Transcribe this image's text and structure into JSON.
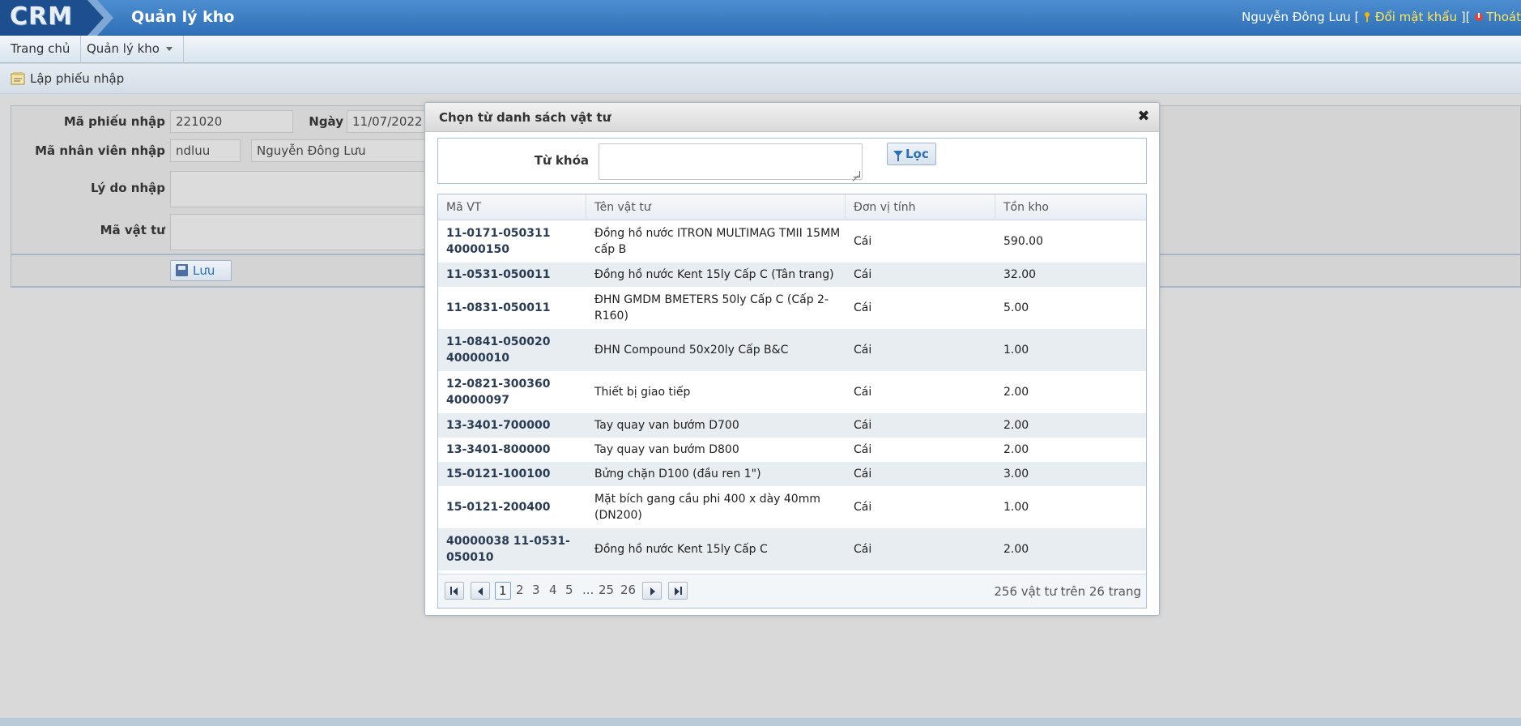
{
  "header": {
    "logo": "CRM",
    "app_title": "Quản lý kho",
    "user_name": "Nguyễn Đông Lưu [",
    "change_password": "Đổi mật khẩu",
    "separator": " ][",
    "logout": "Thoát"
  },
  "menu": {
    "items": [
      {
        "label": "Trang chủ"
      },
      {
        "label": "Quản lý kho"
      }
    ]
  },
  "page": {
    "title": "Lập phiếu nhập"
  },
  "form": {
    "receipt_code_label": "Mã phiếu nhập",
    "receipt_code_value": "221020",
    "date_label": "Ngày",
    "date_value": "11/07/2022",
    "employee_label": "Mã nhân viên nhập",
    "employee_code": "ndluu",
    "employee_name": "Nguyễn Đông Lưu",
    "reason_label": "Lý do nhập",
    "material_label": "Mã vật tư",
    "save_label": "Lưu"
  },
  "dialog": {
    "title": "Chọn từ danh sách vật tư",
    "keyword_label": "Từ khóa",
    "filter_button": "Lọc",
    "columns": [
      "Mã VT",
      "Tên vật tư",
      "Đơn vị tính",
      "Tồn kho"
    ],
    "rows": [
      {
        "code": "11-0171-050311 40000150",
        "name": "Đồng hồ nước ITRON MULTIMAG TMII 15MM cấp B",
        "unit": "Cái",
        "stock": "590.00"
      },
      {
        "code": "11-0531-050011",
        "name": "Đồng hồ nước Kent 15ly Cấp C (Tân trang)",
        "unit": "Cái",
        "stock": "32.00"
      },
      {
        "code": "11-0831-050011",
        "name": "ĐHN GMDM BMETERS 50ly Cấp C (Cấp 2-R160)",
        "unit": "Cái",
        "stock": "5.00"
      },
      {
        "code": "11-0841-050020 40000010",
        "name": "ĐHN Compound 50x20ly Cấp B&C",
        "unit": "Cái",
        "stock": "1.00"
      },
      {
        "code": "12-0821-300360 40000097",
        "name": "Thiết bị giao tiếp",
        "unit": "Cái",
        "stock": "2.00"
      },
      {
        "code": "13-3401-700000",
        "name": "Tay quay van bướm D700",
        "unit": "Cái",
        "stock": "2.00"
      },
      {
        "code": "13-3401-800000",
        "name": "Tay quay van bướm D800",
        "unit": "Cái",
        "stock": "2.00"
      },
      {
        "code": "15-0121-100100",
        "name": "Bửng chặn D100 (đầu ren 1\")",
        "unit": "Cái",
        "stock": "3.00"
      },
      {
        "code": "15-0121-200400",
        "name": "Mặt bích gang cầu phi 400 x dày 40mm (DN200)",
        "unit": "Cái",
        "stock": "1.00"
      },
      {
        "code": "40000038 11-0531-050010",
        "name": "Đồng hồ nước Kent 15ly Cấp C",
        "unit": "Cái",
        "stock": "2.00"
      }
    ],
    "pager": {
      "pages": [
        "1",
        "2",
        "3",
        "4",
        "5",
        "...",
        "25",
        "26"
      ],
      "current": "1",
      "info": "256 vật tư trên 26 trang"
    }
  },
  "colors": {
    "header_blue": "#3a7cc4",
    "link_yellow": "#ffe65c",
    "accent": "#2f6fb6"
  }
}
